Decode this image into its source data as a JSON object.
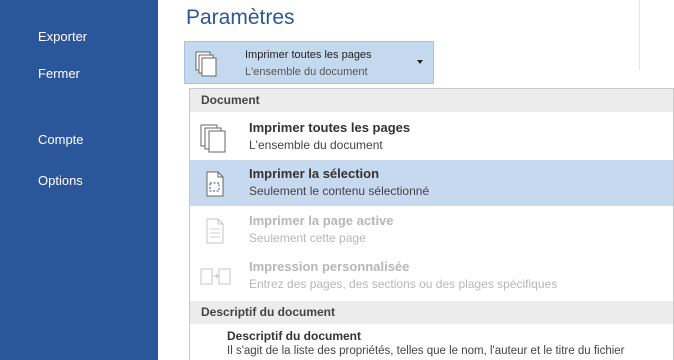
{
  "sidebar": {
    "items": [
      {
        "label": "Exporter"
      },
      {
        "label": "Fermer"
      },
      {
        "label": "Compte"
      },
      {
        "label": "Options"
      }
    ]
  },
  "main": {
    "title": "Paramètres",
    "selector": {
      "title": "Imprimer toutes les pages",
      "subtitle": "L'ensemble du document"
    },
    "dropdown": {
      "section1": "Document",
      "options": [
        {
          "title": "Imprimer toutes les pages",
          "subtitle": "L'ensemble du document",
          "state": "normal"
        },
        {
          "title": "Imprimer la sélection",
          "subtitle": "Seulement le contenu sélectionné",
          "state": "hover"
        },
        {
          "title": "Imprimer la page active",
          "subtitle": "Seulement cette page",
          "state": "disabled"
        },
        {
          "title": "Impression personnalisée",
          "subtitle": "Entrez des pages, des sections ou des plages spécifiques",
          "state": "disabled"
        }
      ],
      "section2": "Descriptif du document",
      "desc": {
        "title": "Descriptif du document",
        "subtitle": "Il s'agit de la liste des propriétés, telles que le nom, l'auteur et le titre du fichier"
      }
    }
  },
  "colors": {
    "sidebar": "#2b579a",
    "highlight": "#c7d9ef",
    "accent": "#2b579a"
  },
  "icons": [
    "pages-stack-icon",
    "selection-page-icon",
    "single-page-icon",
    "custom-pages-icon",
    "mouse-cursor-icon",
    "dropdown-arrow-icon"
  ]
}
